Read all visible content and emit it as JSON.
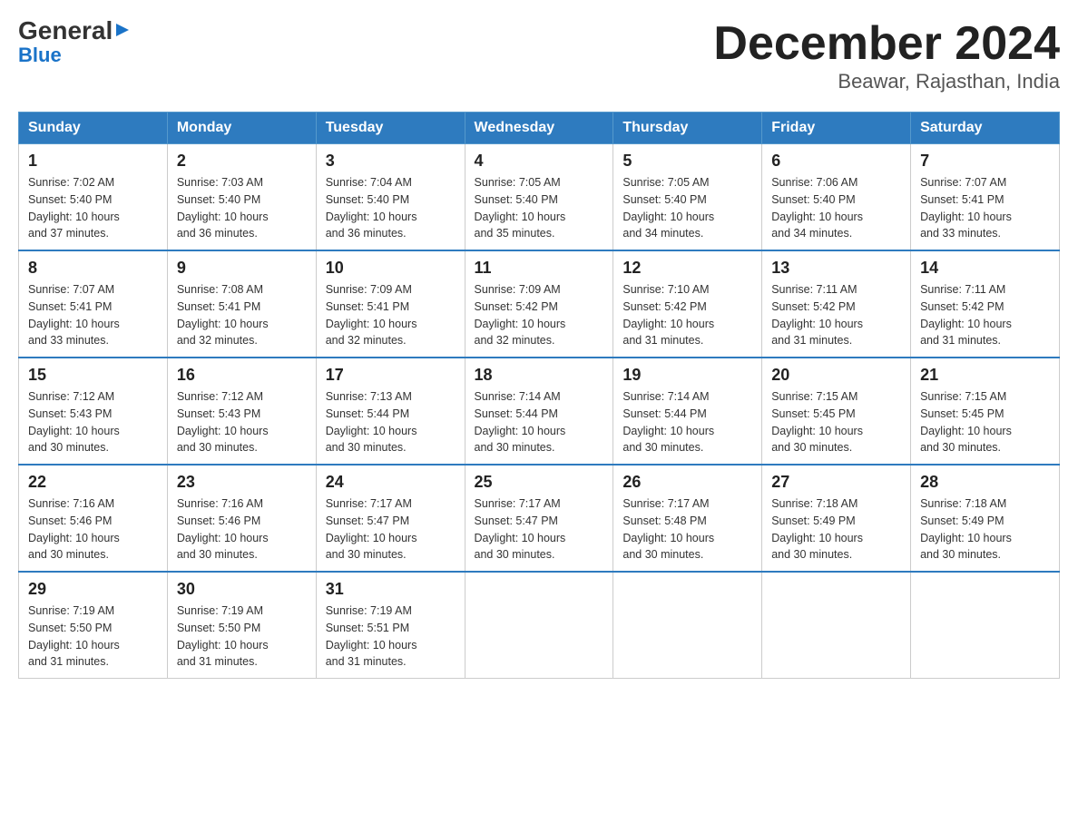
{
  "logo": {
    "general": "General",
    "blue": "Blue",
    "triangle_char": "▶"
  },
  "header": {
    "month_title": "December 2024",
    "subtitle": "Beawar, Rajasthan, India"
  },
  "days_of_week": [
    "Sunday",
    "Monday",
    "Tuesday",
    "Wednesday",
    "Thursday",
    "Friday",
    "Saturday"
  ],
  "weeks": [
    [
      {
        "day": "1",
        "sunrise": "7:02 AM",
        "sunset": "5:40 PM",
        "daylight": "10 hours and 37 minutes."
      },
      {
        "day": "2",
        "sunrise": "7:03 AM",
        "sunset": "5:40 PM",
        "daylight": "10 hours and 36 minutes."
      },
      {
        "day": "3",
        "sunrise": "7:04 AM",
        "sunset": "5:40 PM",
        "daylight": "10 hours and 36 minutes."
      },
      {
        "day": "4",
        "sunrise": "7:05 AM",
        "sunset": "5:40 PM",
        "daylight": "10 hours and 35 minutes."
      },
      {
        "day": "5",
        "sunrise": "7:05 AM",
        "sunset": "5:40 PM",
        "daylight": "10 hours and 34 minutes."
      },
      {
        "day": "6",
        "sunrise": "7:06 AM",
        "sunset": "5:40 PM",
        "daylight": "10 hours and 34 minutes."
      },
      {
        "day": "7",
        "sunrise": "7:07 AM",
        "sunset": "5:41 PM",
        "daylight": "10 hours and 33 minutes."
      }
    ],
    [
      {
        "day": "8",
        "sunrise": "7:07 AM",
        "sunset": "5:41 PM",
        "daylight": "10 hours and 33 minutes."
      },
      {
        "day": "9",
        "sunrise": "7:08 AM",
        "sunset": "5:41 PM",
        "daylight": "10 hours and 32 minutes."
      },
      {
        "day": "10",
        "sunrise": "7:09 AM",
        "sunset": "5:41 PM",
        "daylight": "10 hours and 32 minutes."
      },
      {
        "day": "11",
        "sunrise": "7:09 AM",
        "sunset": "5:42 PM",
        "daylight": "10 hours and 32 minutes."
      },
      {
        "day": "12",
        "sunrise": "7:10 AM",
        "sunset": "5:42 PM",
        "daylight": "10 hours and 31 minutes."
      },
      {
        "day": "13",
        "sunrise": "7:11 AM",
        "sunset": "5:42 PM",
        "daylight": "10 hours and 31 minutes."
      },
      {
        "day": "14",
        "sunrise": "7:11 AM",
        "sunset": "5:42 PM",
        "daylight": "10 hours and 31 minutes."
      }
    ],
    [
      {
        "day": "15",
        "sunrise": "7:12 AM",
        "sunset": "5:43 PM",
        "daylight": "10 hours and 30 minutes."
      },
      {
        "day": "16",
        "sunrise": "7:12 AM",
        "sunset": "5:43 PM",
        "daylight": "10 hours and 30 minutes."
      },
      {
        "day": "17",
        "sunrise": "7:13 AM",
        "sunset": "5:44 PM",
        "daylight": "10 hours and 30 minutes."
      },
      {
        "day": "18",
        "sunrise": "7:14 AM",
        "sunset": "5:44 PM",
        "daylight": "10 hours and 30 minutes."
      },
      {
        "day": "19",
        "sunrise": "7:14 AM",
        "sunset": "5:44 PM",
        "daylight": "10 hours and 30 minutes."
      },
      {
        "day": "20",
        "sunrise": "7:15 AM",
        "sunset": "5:45 PM",
        "daylight": "10 hours and 30 minutes."
      },
      {
        "day": "21",
        "sunrise": "7:15 AM",
        "sunset": "5:45 PM",
        "daylight": "10 hours and 30 minutes."
      }
    ],
    [
      {
        "day": "22",
        "sunrise": "7:16 AM",
        "sunset": "5:46 PM",
        "daylight": "10 hours and 30 minutes."
      },
      {
        "day": "23",
        "sunrise": "7:16 AM",
        "sunset": "5:46 PM",
        "daylight": "10 hours and 30 minutes."
      },
      {
        "day": "24",
        "sunrise": "7:17 AM",
        "sunset": "5:47 PM",
        "daylight": "10 hours and 30 minutes."
      },
      {
        "day": "25",
        "sunrise": "7:17 AM",
        "sunset": "5:47 PM",
        "daylight": "10 hours and 30 minutes."
      },
      {
        "day": "26",
        "sunrise": "7:17 AM",
        "sunset": "5:48 PM",
        "daylight": "10 hours and 30 minutes."
      },
      {
        "day": "27",
        "sunrise": "7:18 AM",
        "sunset": "5:49 PM",
        "daylight": "10 hours and 30 minutes."
      },
      {
        "day": "28",
        "sunrise": "7:18 AM",
        "sunset": "5:49 PM",
        "daylight": "10 hours and 30 minutes."
      }
    ],
    [
      {
        "day": "29",
        "sunrise": "7:19 AM",
        "sunset": "5:50 PM",
        "daylight": "10 hours and 31 minutes."
      },
      {
        "day": "30",
        "sunrise": "7:19 AM",
        "sunset": "5:50 PM",
        "daylight": "10 hours and 31 minutes."
      },
      {
        "day": "31",
        "sunrise": "7:19 AM",
        "sunset": "5:51 PM",
        "daylight": "10 hours and 31 minutes."
      },
      null,
      null,
      null,
      null
    ]
  ],
  "labels": {
    "sunrise": "Sunrise:",
    "sunset": "Sunset:",
    "daylight": "Daylight:"
  }
}
